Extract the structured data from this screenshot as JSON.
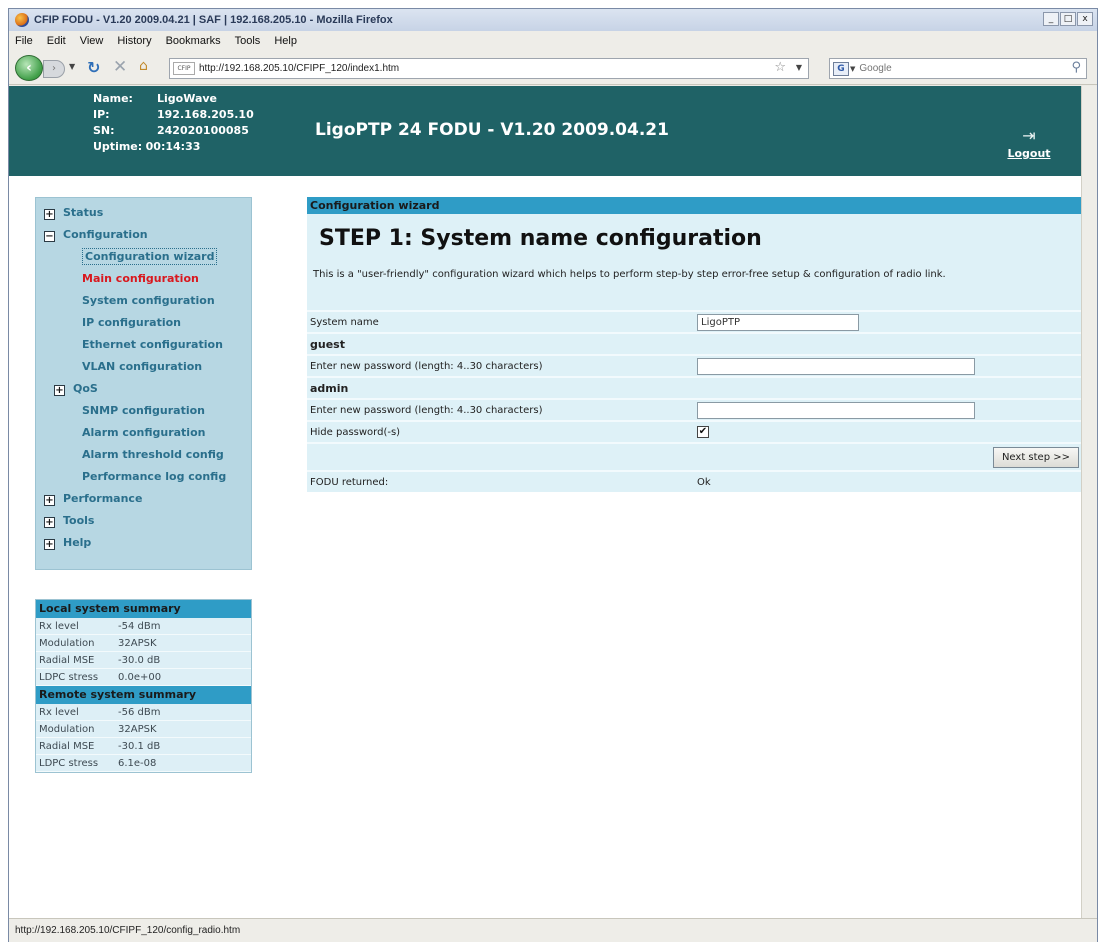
{
  "browser": {
    "window_title": "CFIP FODU - V1.20 2009.04.21 | SAF | 192.168.205.10 - Mozilla Firefox",
    "window_buttons": [
      "_",
      "□",
      "x"
    ],
    "menu": [
      "File",
      "Edit",
      "View",
      "History",
      "Bookmarks",
      "Tools",
      "Help"
    ],
    "url": "http://192.168.205.10/CFIPF_120/index1.htm",
    "site_badge": "CFIP",
    "search_engine": "G",
    "search_placeholder": "Google",
    "status_text": "http://192.168.205.10/CFIPF_120/config_radio.htm"
  },
  "header": {
    "name_label": "Name:",
    "name_value": "LigoWave",
    "ip_label": "IP:",
    "ip_value": "192.168.205.10",
    "sn_label": "SN:",
    "sn_value": "242020100085",
    "uptime_label": "Uptime:",
    "uptime_value": "00:14:33",
    "title": "LigoPTP 24 FODU - V1.20 2009.04.21",
    "logout_label": "Logout"
  },
  "menu": {
    "status": "Status",
    "configuration": "Configuration",
    "config_items": [
      "Configuration wizard",
      "Main configuration",
      "System configuration",
      "IP configuration",
      "Ethernet configuration",
      "VLAN configuration"
    ],
    "qos": "QoS",
    "config_items_2": [
      "SNMP configuration",
      "Alarm configuration",
      "Alarm threshold config",
      "Performance log config"
    ],
    "performance": "Performance",
    "tools": "Tools",
    "help": "Help",
    "expand_symbol": "+",
    "collapse_symbol": "−"
  },
  "local_summary": {
    "title": "Local system summary",
    "rows": [
      {
        "k": "Rx level",
        "v": "-54 dBm"
      },
      {
        "k": "Modulation",
        "v": "32APSK"
      },
      {
        "k": "Radial MSE",
        "v": "-30.0 dB"
      },
      {
        "k": "LDPC stress",
        "v": "0.0e+00"
      }
    ]
  },
  "remote_summary": {
    "title": "Remote system summary",
    "rows": [
      {
        "k": "Rx level",
        "v": "-56 dBm"
      },
      {
        "k": "Modulation",
        "v": "32APSK"
      },
      {
        "k": "Radial MSE",
        "v": "-30.1 dB"
      },
      {
        "k": "LDPC stress",
        "v": "6.1e-08"
      }
    ]
  },
  "wizard": {
    "header": "Configuration wizard",
    "step_title": "STEP 1: System name configuration",
    "description": "This is a \"user-friendly\" configuration wizard which helps to perform step-by step error-free setup & configuration of radio link.",
    "system_name_label": "System name",
    "system_name_value": "LigoPTP",
    "guest_label": "guest",
    "guest_pw_label": "Enter new password (length: 4..30 characters)",
    "guest_pw_value": "",
    "admin_label": "admin",
    "admin_pw_label": "Enter new password (length: 4..30 characters)",
    "admin_pw_value": "",
    "hide_pw_label": "Hide password(-s)",
    "hide_pw_checked": true,
    "hide_pw_mark": "✔",
    "next_label": "Next step >>",
    "returned_label": "FODU returned:",
    "returned_value": "Ok"
  },
  "colors": {
    "header_bg": "#1f6266",
    "menu_bg": "#b7d7e3",
    "section_head": "#2f9cc6",
    "active_item": "#d9181e",
    "link": "#2a6f8c"
  }
}
